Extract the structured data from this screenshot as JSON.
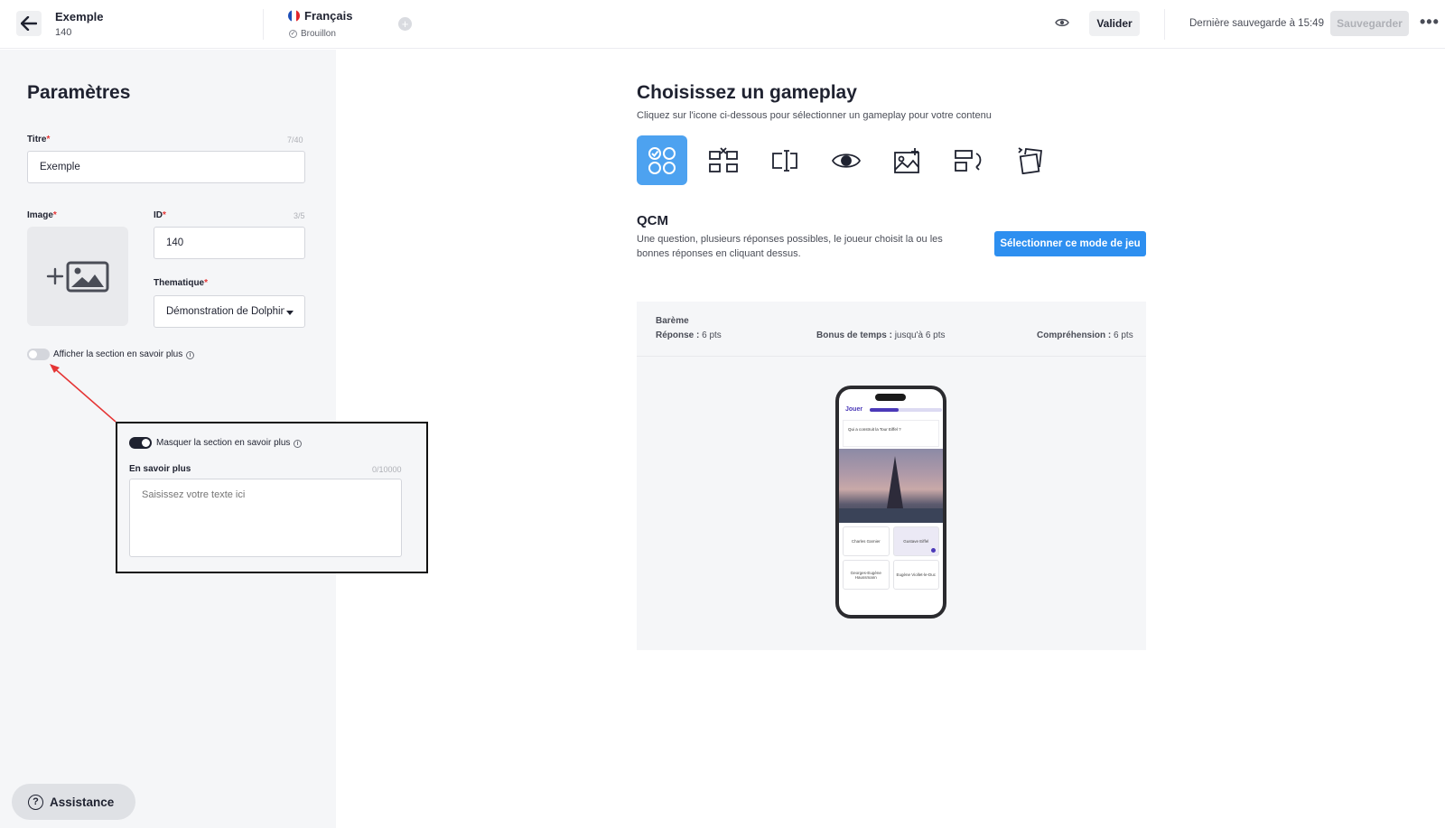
{
  "header": {
    "title": "Exemple",
    "id": "140",
    "language": "Français",
    "status": "Brouillon",
    "valider_label": "Valider",
    "last_save": "Dernière sauvegarde à 15:49",
    "save_label": "Sauvegarder",
    "more_label": "•••"
  },
  "sidebar": {
    "title": "Paramètres",
    "titre_label": "Titre",
    "titre_counter": "7/40",
    "titre_value": "Exemple",
    "image_label": "Image",
    "id_label": "ID",
    "id_counter": "3/5",
    "id_value": "140",
    "thematique_label": "Thematique",
    "thematique_value": "Démonstration de Dolphin",
    "toggle_off_label": "Afficher la section en savoir plus",
    "toggle_on_label": "Masquer la section en savoir plus",
    "savoir_plus_label": "En savoir plus",
    "savoir_plus_counter": "0/10000",
    "savoir_plus_placeholder": "Saisissez votre texte ici",
    "assistance_label": "Assistance"
  },
  "main": {
    "title": "Choisissez un gameplay",
    "subtitle": "Cliquez sur l'icone ci-dessous pour sélectionner un gameplay pour votre contenu",
    "gameplay_icons": [
      "qcm-icon",
      "matching-icon",
      "text-input-icon",
      "eye-icon",
      "image-target-icon",
      "reorder-icon",
      "flip-card-icon"
    ],
    "mode_title": "QCM",
    "mode_desc": "Une question, plusieurs réponses possibles, le joueur choisit la ou les bonnes réponses en cliquant dessus.",
    "select_mode_label": "Sélectionner ce mode de jeu",
    "bareme": {
      "title": "Barème",
      "reponse_label": "Réponse :",
      "reponse_value": "6 pts",
      "bonus_label": "Bonus de temps :",
      "bonus_value": "jusqu'à 6 pts",
      "comprehension_label": "Compréhension :",
      "comprehension_value": "6 pts"
    },
    "phone": {
      "header": "Jouer",
      "progress": 0.4,
      "question": "Qui a construit la Tour Eiffel ?",
      "answers": [
        "Charles Garnier",
        "Gustave Eiffel",
        "Georges-Eugène Haussmann",
        "Eugène Viollet-le-Duc"
      ]
    }
  },
  "colors": {
    "accent": "#2d8ff0",
    "active_icon_bg": "#4da2f0",
    "annotation_arrow": "#e53535",
    "phone_accent": "#4b39b8"
  }
}
